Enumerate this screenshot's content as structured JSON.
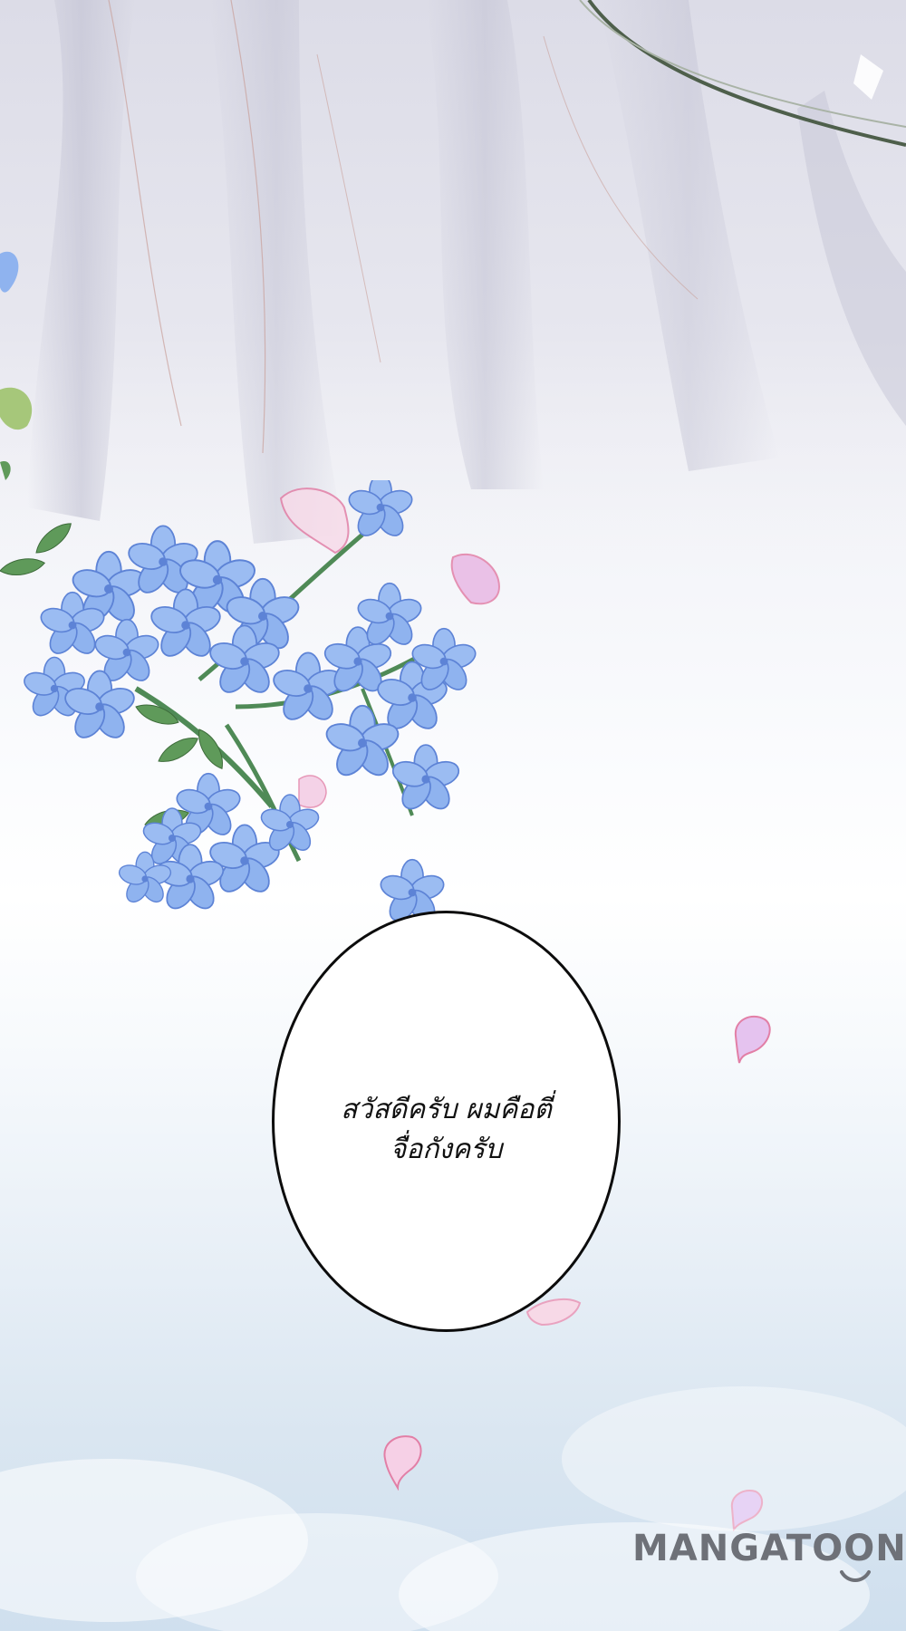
{
  "scene": {
    "colors": {
      "sky_top": "#e9e9f1",
      "sky_bottom": "#cfdfee",
      "robe": "#c9c9d8",
      "flower": "#8fb3ef",
      "flower_dark": "#5d83d6",
      "leaf": "#5f9a5a",
      "petal": "#f3c8e2",
      "petal_outline": "#e27fa6",
      "bubble_fill": "#ffffff",
      "bubble_outline": "#0c0c0c"
    },
    "icons": {
      "hanging_robe": "robe-drape-icon",
      "flower_cluster": "blue-flower-cluster-icon",
      "falling_petal": "pink-petal-icon",
      "clouds": "cloud-icon",
      "logo_smile": "smile-icon"
    }
  },
  "speech_bubble": {
    "lines": [
      "สวัสดีครับ ผมคือตี่",
      "จื่อกังครับ"
    ]
  },
  "watermark": {
    "text": "MANGATOON"
  }
}
